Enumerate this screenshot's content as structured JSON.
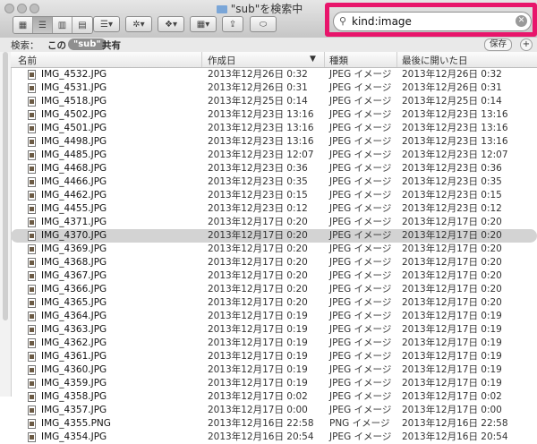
{
  "window": {
    "title": "\"sub\"を検索中"
  },
  "toolbar": {
    "view_icons": [
      "icon-view-icon",
      "list-view-icon",
      "column-view-icon",
      "coverflow-view-icon"
    ],
    "arrange_icon": "arrange-icon",
    "action_icon": "gear-icon",
    "dropbox_icon": "dropbox-icon",
    "grid_icon": "grid-icon",
    "share_icon": "share-icon",
    "toggle_icon": "toggle-icon"
  },
  "search": {
    "value": "kind:image",
    "highlight_color": "#e8156b"
  },
  "scope": {
    "label": "検索：",
    "this_mac": "この Mac",
    "sub": "\"sub\"",
    "shared": "共有",
    "save": "保存",
    "plus": "+"
  },
  "columns": {
    "name": "名前",
    "created": "作成日",
    "kind": "種類",
    "last_opened": "最後に開いた日",
    "sort_indicator": "▼"
  },
  "files": [
    {
      "name": "IMG_4532.JPG",
      "created": "2013年12月26日 0:32",
      "kind": "JPEG イメージ",
      "opened": "2013年12月26日 0:32"
    },
    {
      "name": "IMG_4531.JPG",
      "created": "2013年12月26日 0:31",
      "kind": "JPEG イメージ",
      "opened": "2013年12月26日 0:31"
    },
    {
      "name": "IMG_4518.JPG",
      "created": "2013年12月25日 0:14",
      "kind": "JPEG イメージ",
      "opened": "2013年12月25日 0:14"
    },
    {
      "name": "IMG_4502.JPG",
      "created": "2013年12月23日 13:16",
      "kind": "JPEG イメージ",
      "opened": "2013年12月23日 13:16"
    },
    {
      "name": "IMG_4501.JPG",
      "created": "2013年12月23日 13:16",
      "kind": "JPEG イメージ",
      "opened": "2013年12月23日 13:16"
    },
    {
      "name": "IMG_4498.JPG",
      "created": "2013年12月23日 13:16",
      "kind": "JPEG イメージ",
      "opened": "2013年12月23日 13:16"
    },
    {
      "name": "IMG_4485.JPG",
      "created": "2013年12月23日 12:07",
      "kind": "JPEG イメージ",
      "opened": "2013年12月23日 12:07"
    },
    {
      "name": "IMG_4468.JPG",
      "created": "2013年12月23日 0:36",
      "kind": "JPEG イメージ",
      "opened": "2013年12月23日 0:36"
    },
    {
      "name": "IMG_4466.JPG",
      "created": "2013年12月23日 0:35",
      "kind": "JPEG イメージ",
      "opened": "2013年12月23日 0:35"
    },
    {
      "name": "IMG_4462.JPG",
      "created": "2013年12月23日 0:15",
      "kind": "JPEG イメージ",
      "opened": "2013年12月23日 0:15"
    },
    {
      "name": "IMG_4455.JPG",
      "created": "2013年12月23日 0:12",
      "kind": "JPEG イメージ",
      "opened": "2013年12月23日 0:12"
    },
    {
      "name": "IMG_4371.JPG",
      "created": "2013年12月17日 0:20",
      "kind": "JPEG イメージ",
      "opened": "2013年12月17日 0:20"
    },
    {
      "name": "IMG_4370.JPG",
      "created": "2013年12月17日 0:20",
      "kind": "JPEG イメージ",
      "opened": "2013年12月17日 0:20",
      "selected": true
    },
    {
      "name": "IMG_4369.JPG",
      "created": "2013年12月17日 0:20",
      "kind": "JPEG イメージ",
      "opened": "2013年12月17日 0:20"
    },
    {
      "name": "IMG_4368.JPG",
      "created": "2013年12月17日 0:20",
      "kind": "JPEG イメージ",
      "opened": "2013年12月17日 0:20"
    },
    {
      "name": "IMG_4367.JPG",
      "created": "2013年12月17日 0:20",
      "kind": "JPEG イメージ",
      "opened": "2013年12月17日 0:20"
    },
    {
      "name": "IMG_4366.JPG",
      "created": "2013年12月17日 0:20",
      "kind": "JPEG イメージ",
      "opened": "2013年12月17日 0:20"
    },
    {
      "name": "IMG_4365.JPG",
      "created": "2013年12月17日 0:20",
      "kind": "JPEG イメージ",
      "opened": "2013年12月17日 0:20"
    },
    {
      "name": "IMG_4364.JPG",
      "created": "2013年12月17日 0:19",
      "kind": "JPEG イメージ",
      "opened": "2013年12月17日 0:19"
    },
    {
      "name": "IMG_4363.JPG",
      "created": "2013年12月17日 0:19",
      "kind": "JPEG イメージ",
      "opened": "2013年12月17日 0:19"
    },
    {
      "name": "IMG_4362.JPG",
      "created": "2013年12月17日 0:19",
      "kind": "JPEG イメージ",
      "opened": "2013年12月17日 0:19"
    },
    {
      "name": "IMG_4361.JPG",
      "created": "2013年12月17日 0:19",
      "kind": "JPEG イメージ",
      "opened": "2013年12月17日 0:19"
    },
    {
      "name": "IMG_4360.JPG",
      "created": "2013年12月17日 0:19",
      "kind": "JPEG イメージ",
      "opened": "2013年12月17日 0:19"
    },
    {
      "name": "IMG_4359.JPG",
      "created": "2013年12月17日 0:19",
      "kind": "JPEG イメージ",
      "opened": "2013年12月17日 0:19"
    },
    {
      "name": "IMG_4358.JPG",
      "created": "2013年12月17日 0:02",
      "kind": "JPEG イメージ",
      "opened": "2013年12月17日 0:02"
    },
    {
      "name": "IMG_4357.JPG",
      "created": "2013年12月17日 0:00",
      "kind": "JPEG イメージ",
      "opened": "2013年12月17日 0:00"
    },
    {
      "name": "IMG_4355.PNG",
      "created": "2013年12月16日 22:58",
      "kind": "PNG イメージ",
      "opened": "2013年12月16日 22:58"
    },
    {
      "name": "IMG_4354.JPG",
      "created": "2013年12月16日 20:54",
      "kind": "JPEG イメージ",
      "opened": "2013年12月16日 20:54"
    }
  ]
}
